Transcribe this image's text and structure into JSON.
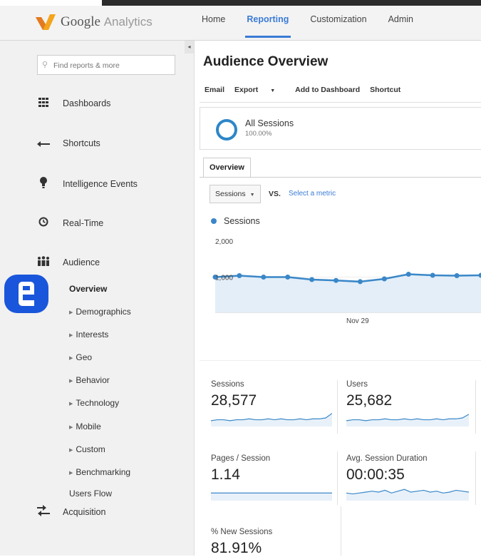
{
  "app": {
    "logo_google": "Google",
    "logo_product": "Analytics",
    "brand_colors": {
      "orange": "#f4a41d",
      "blue": "#3a7bd5"
    }
  },
  "nav": {
    "items": [
      {
        "label": "Home",
        "active": false
      },
      {
        "label": "Reporting",
        "active": true
      },
      {
        "label": "Customization",
        "active": false
      },
      {
        "label": "Admin",
        "active": false
      }
    ],
    "collapse_glyph": "◂"
  },
  "sidebar": {
    "search_placeholder": "Find reports & more",
    "items": [
      {
        "label": "Dashboards",
        "icon": "grid-icon"
      },
      {
        "label": "Shortcuts",
        "icon": "arrow-left-icon"
      },
      {
        "label": "Intelligence Events",
        "icon": "lightbulb-icon"
      },
      {
        "label": "Real-Time",
        "icon": "clock-icon"
      },
      {
        "label": "Audience",
        "icon": "people-icon"
      }
    ],
    "audience_sub": [
      {
        "label": "Overview",
        "active": true,
        "expandable": false
      },
      {
        "label": "Demographics",
        "expandable": true
      },
      {
        "label": "Interests",
        "expandable": true
      },
      {
        "label": "Geo",
        "expandable": true
      },
      {
        "label": "Behavior",
        "expandable": true
      },
      {
        "label": "Technology",
        "expandable": true
      },
      {
        "label": "Mobile",
        "expandable": true
      },
      {
        "label": "Custom",
        "expandable": true
      },
      {
        "label": "Benchmarking",
        "expandable": true
      },
      {
        "label": "Users Flow",
        "expandable": false
      }
    ],
    "acquisition": {
      "label": "Acquisition",
      "icon": "acquisition-icon"
    }
  },
  "main": {
    "title": "Audience Overview",
    "toolbar": {
      "email": "Email",
      "export": "Export",
      "add_to_dashboard": "Add to Dashboard",
      "shortcut": "Shortcut"
    },
    "segment": {
      "name": "All Sessions",
      "percent": "100.00%"
    },
    "tab": "Overview",
    "metric_selector": {
      "value": "Sessions",
      "vs": "VS.",
      "select_metric": "Select a metric"
    },
    "legend": "Sessions"
  },
  "chart_data": {
    "type": "area",
    "series": [
      {
        "name": "Sessions",
        "values": [
          1000,
          1040,
          1000,
          1000,
          930,
          905,
          870,
          950,
          1080,
          1050,
          1040,
          1050
        ]
      }
    ],
    "yticks": [
      "2,000",
      "1,000"
    ],
    "ylim": [
      0,
      2000
    ],
    "xlabel_tick": "Nov 29",
    "color": "#3a87c8"
  },
  "metrics": [
    {
      "label": "Sessions",
      "value": "28,577",
      "spark": [
        4,
        5,
        5,
        4,
        5,
        5,
        6,
        5,
        5,
        6,
        5,
        6,
        5,
        5,
        6,
        5,
        6,
        6,
        7,
        12
      ]
    },
    {
      "label": "Users",
      "value": "25,682",
      "spark": [
        4,
        5,
        5,
        4,
        5,
        5,
        6,
        5,
        5,
        6,
        5,
        6,
        5,
        5,
        6,
        5,
        6,
        6,
        7,
        11
      ]
    },
    {
      "label": "Pages / Session",
      "value": "1.14",
      "spark": [
        6,
        6,
        6,
        6,
        6,
        6,
        6,
        6,
        6,
        6,
        6,
        6,
        6,
        6,
        6,
        6,
        6,
        6,
        6,
        6
      ]
    },
    {
      "label": "Avg. Session Duration",
      "value": "00:00:35",
      "spark": [
        6,
        5,
        6,
        7,
        8,
        7,
        9,
        6,
        8,
        10,
        7,
        8,
        9,
        7,
        8,
        6,
        7,
        9,
        8,
        7
      ]
    },
    {
      "label": "% New Sessions",
      "value": "81.91%",
      "spark": []
    }
  ]
}
